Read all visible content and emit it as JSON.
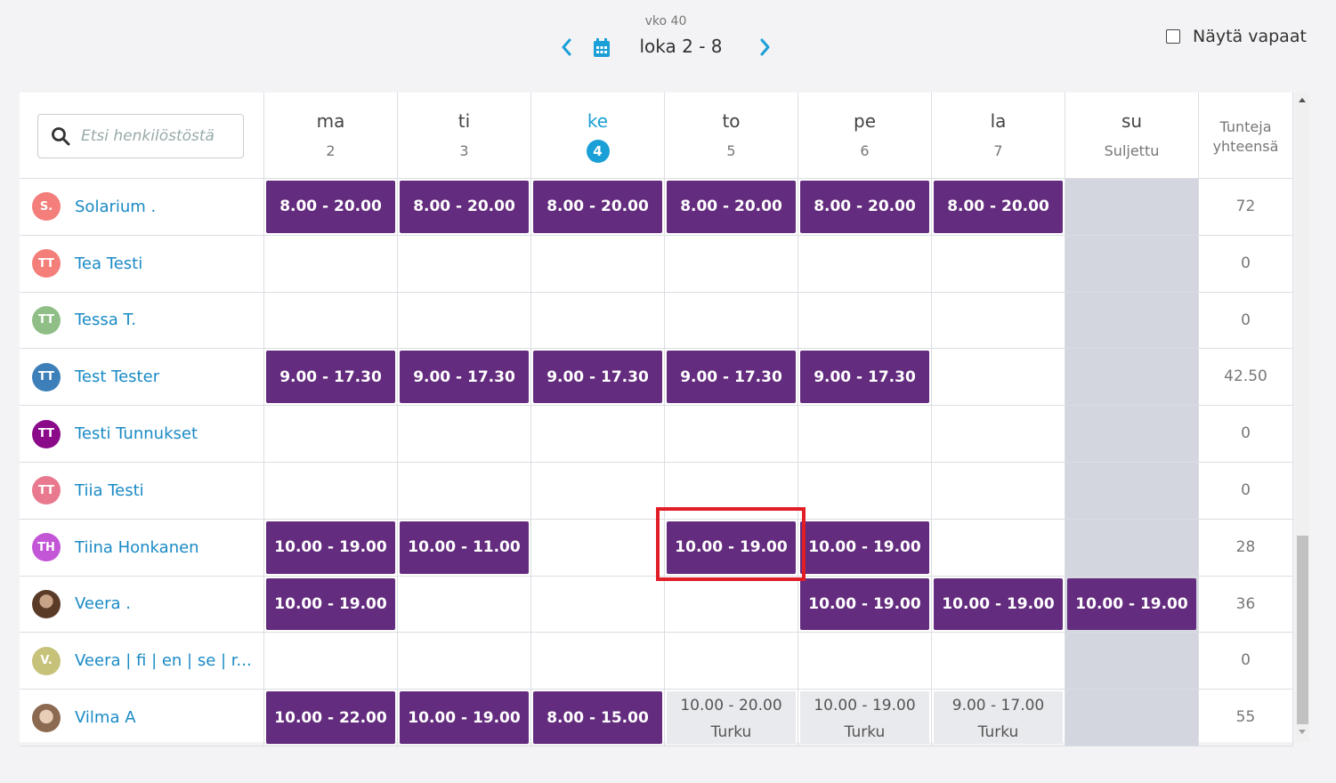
{
  "header": {
    "week_label": "vko 40",
    "date_range": "loka 2 - 8",
    "show_free_label": "Näytä vapaat",
    "show_free_checked": false
  },
  "table": {
    "search_placeholder": "Etsi henkilöstöstä",
    "days": [
      {
        "name": "ma",
        "sub": "2"
      },
      {
        "name": "ti",
        "sub": "3"
      },
      {
        "name": "ke",
        "sub": "4",
        "today": true
      },
      {
        "name": "to",
        "sub": "5"
      },
      {
        "name": "pe",
        "sub": "6"
      },
      {
        "name": "la",
        "sub": "7"
      },
      {
        "name": "su",
        "sub": "Suljettu",
        "closed": true
      }
    ],
    "total_header_line1": "Tunteja",
    "total_header_line2": "yhteensä",
    "rows": [
      {
        "name": "Solarium .",
        "initials": "S.",
        "avatar_color": "#f47e7a",
        "shifts": [
          "8.00 - 20.00",
          "8.00 - 20.00",
          "8.00 - 20.00",
          "8.00 - 20.00",
          "8.00 - 20.00",
          "8.00 - 20.00",
          ""
        ],
        "total": "72"
      },
      {
        "name": "Tea Testi",
        "initials": "TT",
        "avatar_color": "#f47e7a",
        "shifts": [
          "",
          "",
          "",
          "",
          "",
          "",
          ""
        ],
        "total": "0"
      },
      {
        "name": "Tessa T.",
        "initials": "TT",
        "avatar_color": "#8fbf87",
        "shifts": [
          "",
          "",
          "",
          "",
          "",
          "",
          ""
        ],
        "total": "0"
      },
      {
        "name": "Test Tester",
        "initials": "TT",
        "avatar_color": "#3d7fb8",
        "shifts": [
          "9.00 - 17.30",
          "9.00 - 17.30",
          "9.00 - 17.30",
          "9.00 - 17.30",
          "9.00 - 17.30",
          "",
          ""
        ],
        "total": "42.50"
      },
      {
        "name": "Testi Tunnukset",
        "initials": "TT",
        "avatar_color": "#8a0a8a",
        "shifts": [
          "",
          "",
          "",
          "",
          "",
          "",
          ""
        ],
        "total": "0"
      },
      {
        "name": "Tiia Testi",
        "initials": "TT",
        "avatar_color": "#e9798e",
        "shifts": [
          "",
          "",
          "",
          "",
          "",
          "",
          ""
        ],
        "total": "0"
      },
      {
        "name": "Tiina Honkanen",
        "initials": "TH",
        "avatar_color": "#c256d6",
        "shifts": [
          "10.00 - 19.00",
          "10.00 - 11.00",
          "",
          "10.00 - 19.00",
          "10.00 - 19.00",
          "",
          ""
        ],
        "total": "28"
      },
      {
        "name": "Veera .",
        "initials": "",
        "avatar_color": "#6b4a35",
        "photo": true,
        "shifts": [
          "10.00 - 19.00",
          "",
          "",
          "",
          "10.00 - 19.00",
          "10.00 - 19.00",
          "10.00 - 19.00"
        ],
        "total": "36"
      },
      {
        "name": "Veera | fi | en | se | r...",
        "initials": "V.",
        "avatar_color": "#c7c27a",
        "shifts": [
          "",
          "",
          "",
          "",
          "",
          "",
          ""
        ],
        "total": "0"
      },
      {
        "name": "Vilma A",
        "initials": "",
        "avatar_color": "#8c6a52",
        "photo2": true,
        "shifts": [
          "10.00 - 22.00",
          "10.00 - 19.00",
          "8.00 - 15.00",
          "10.00 - 20.00|Turku",
          "10.00 - 19.00|Turku",
          "9.00 - 17.00|Turku",
          ""
        ],
        "total": "55"
      }
    ]
  },
  "icons": {
    "prev": "chevron-left-icon",
    "next": "chevron-right-icon",
    "calendar": "calendar-icon",
    "search": "search-icon"
  },
  "colors": {
    "shift": "#642c7e",
    "accent": "#1a9fd6",
    "sunday": "#d3d6df",
    "highlight": "#e11e26"
  }
}
